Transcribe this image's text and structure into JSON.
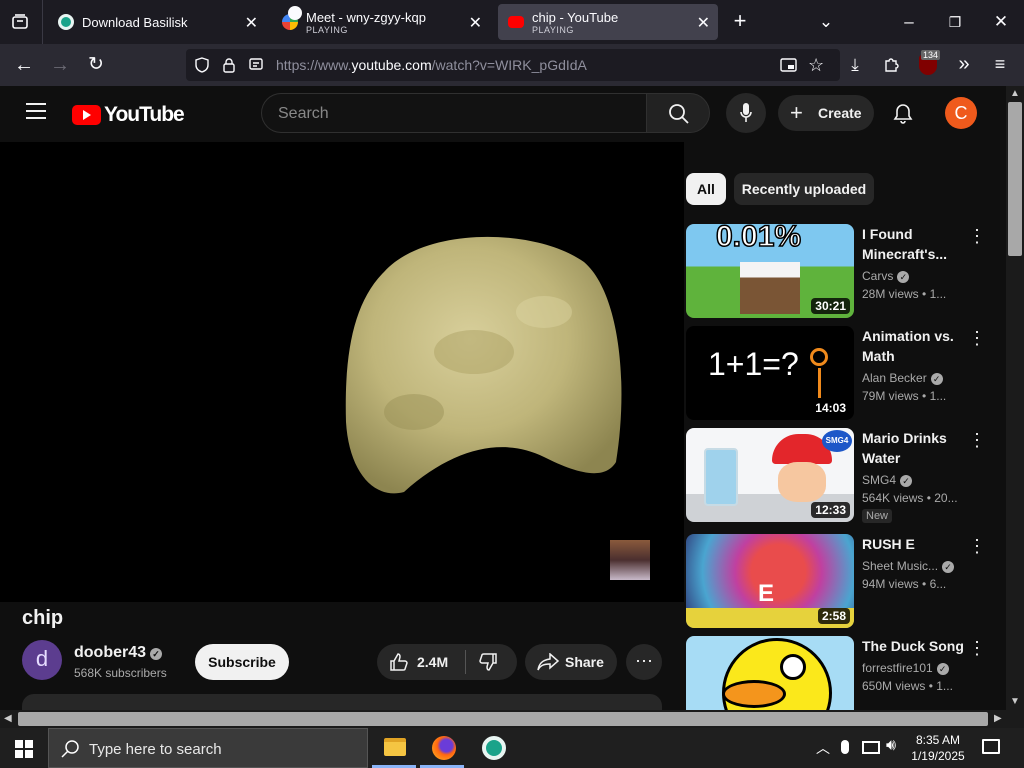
{
  "browser": {
    "tabs": [
      {
        "title": "Download Basilisk",
        "status": ""
      },
      {
        "title": "Meet - wny-zgyy-kqp",
        "status": "PLAYING"
      },
      {
        "title": "chip - YouTube",
        "status": "PLAYING"
      }
    ],
    "url_prefix": "https://www.",
    "url_domain": "youtube.com",
    "url_path": "/watch?v=WIRK_pGdIdA",
    "ext_badge": "134"
  },
  "youtube": {
    "logo_text": "YouTube",
    "search_placeholder": "Search",
    "create_label": "Create",
    "avatar_letter": "C",
    "colors": {
      "brand_red": "#ff0000",
      "avatar": "#ef5a1c"
    }
  },
  "video": {
    "title": "chip",
    "channel": "doober43",
    "channel_initial": "d",
    "subscribers": "568K subscribers",
    "subscribe_label": "Subscribe",
    "likes": "2.4M",
    "share_label": "Share"
  },
  "filters": [
    "All",
    "Recently uploaded"
  ],
  "recommendations": [
    {
      "title": "I Found Minecraft's...",
      "channel": "Carvs",
      "views": "28M views",
      "age": "1...",
      "duration": "30:21",
      "thumb_text": "0.01%",
      "badge": ""
    },
    {
      "title": "Animation vs. Math",
      "channel": "Alan Becker",
      "views": "79M views",
      "age": "1...",
      "duration": "14:03",
      "thumb_text": "1+1=?",
      "badge": ""
    },
    {
      "title": "Mario Drinks Water",
      "channel": "SMG4",
      "views": "564K views",
      "age": "20...",
      "duration": "12:33",
      "thumb_text": "SMG4",
      "badge": "New"
    },
    {
      "title": "RUSH E",
      "channel": "Sheet Music...",
      "views": "94M views",
      "age": "6...",
      "duration": "2:58",
      "thumb_text": "E",
      "badge": ""
    },
    {
      "title": "The Duck Song",
      "channel": "forrestfire101",
      "views": "650M views",
      "age": "1...",
      "duration": "",
      "thumb_text": "",
      "badge": ""
    }
  ],
  "taskbar": {
    "search_placeholder": "Type here to search",
    "time": "8:35 AM",
    "date": "1/19/2025"
  }
}
